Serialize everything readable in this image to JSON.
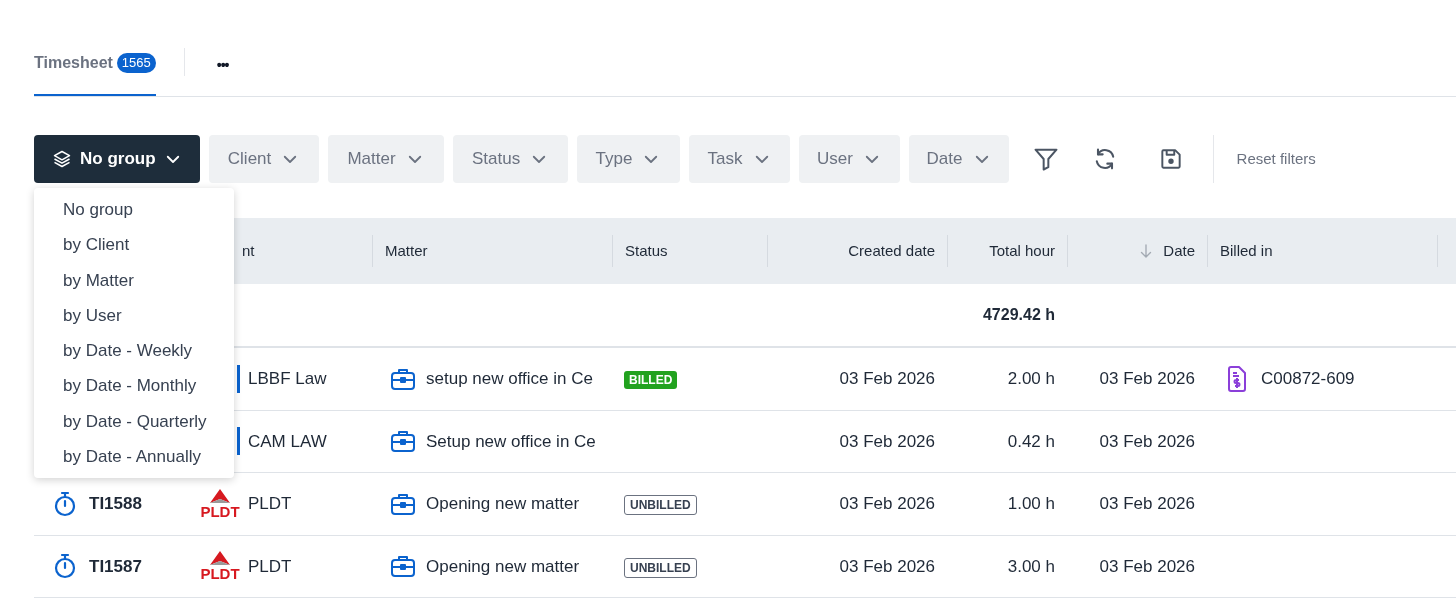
{
  "tabs": [
    {
      "label": "Timesheet",
      "count": "1565",
      "selected": true
    }
  ],
  "more_menu": "•••",
  "toolbar": {
    "group_button": "No group",
    "filters": [
      "Client",
      "Matter",
      "Status",
      "Type",
      "Task",
      "User",
      "Date"
    ],
    "reset": "Reset filters"
  },
  "group_menu": {
    "items": [
      "No group",
      "by Client",
      "by Matter",
      "by User",
      "by Date - Weekly",
      "by Date - Monthly",
      "by Date - Quarterly",
      "by Date - Annually"
    ]
  },
  "table": {
    "columns": [
      {
        "label": "nt"
      },
      {
        "label": "Matter"
      },
      {
        "label": "Status"
      },
      {
        "label": "Created date"
      },
      {
        "label": "Total hour"
      },
      {
        "label": "Date",
        "sorted": true
      },
      {
        "label": "Billed in"
      }
    ],
    "total_hours": "4729.42 h",
    "rows": [
      {
        "client": "LBBF Law",
        "logo": {
          "kind": "partial"
        },
        "matter": "setup new office in Ce",
        "status": {
          "kind": "billed",
          "label": "BILLED"
        },
        "created": "03 Feb 2026",
        "hours": "2.00 h",
        "date": "03 Feb 2026",
        "billed_in": "C00872-609"
      },
      {
        "client": "CAM LAW",
        "logo": {
          "kind": "partial"
        },
        "matter": "Setup new office in Ce",
        "created": "03 Feb 2026",
        "hours": "0.42 h",
        "date": "03 Feb 2026"
      },
      {
        "id": "TI1588",
        "client": "PLDT",
        "logo": {
          "kind": "pldt",
          "text": "PLDT"
        },
        "matter": "Opening new matter",
        "status": {
          "kind": "unbilled",
          "label": "UNBILLED"
        },
        "created": "03 Feb 2026",
        "hours": "1.00 h",
        "date": "03 Feb 2026"
      },
      {
        "id": "TI1587",
        "client": "PLDT",
        "logo": {
          "kind": "pldt",
          "text": "PLDT"
        },
        "matter": "Opening new matter",
        "status": {
          "kind": "unbilled",
          "label": "UNBILLED"
        },
        "created": "03 Feb 2026",
        "hours": "3.00 h",
        "date": "03 Feb 2026"
      }
    ]
  }
}
